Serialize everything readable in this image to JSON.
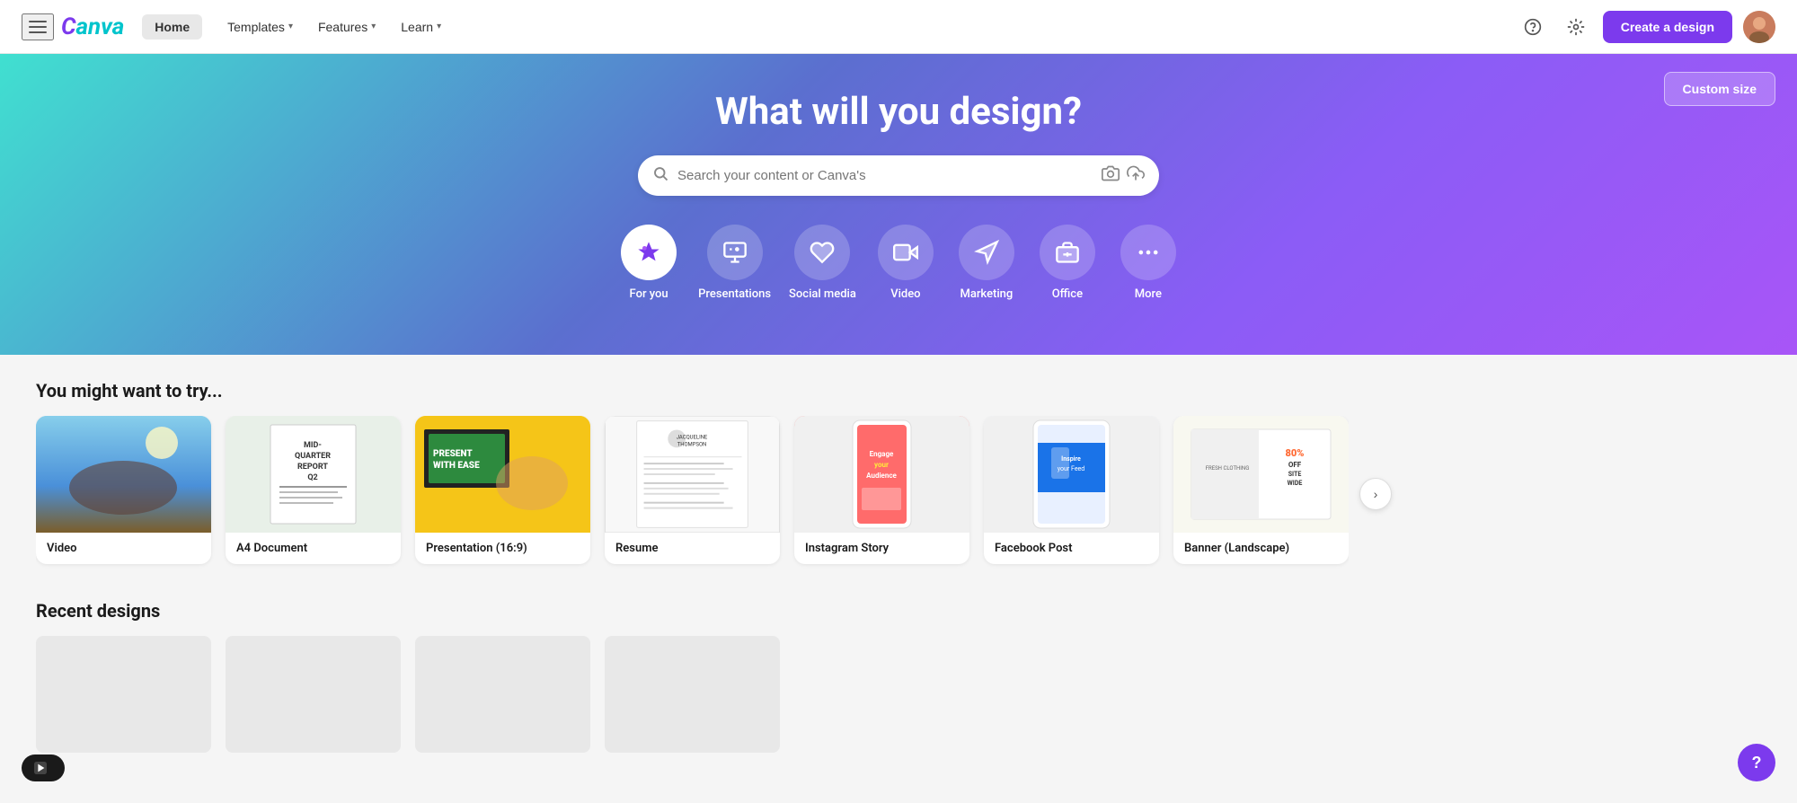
{
  "navbar": {
    "logo": "Canva",
    "home_label": "Home",
    "templates_label": "Templates",
    "features_label": "Features",
    "learn_label": "Learn",
    "create_btn": "Create a design",
    "help_tooltip": "Help",
    "settings_tooltip": "Settings"
  },
  "hero": {
    "title": "What will you design?",
    "search_placeholder": "Search your content or Canva's",
    "custom_size_label": "Custom size"
  },
  "categories": [
    {
      "id": "for-you",
      "label": "For you",
      "icon": "sparkle",
      "active": true
    },
    {
      "id": "presentations",
      "label": "Presentations",
      "icon": "presentation"
    },
    {
      "id": "social-media",
      "label": "Social media",
      "icon": "heart"
    },
    {
      "id": "video",
      "label": "Video",
      "icon": "video"
    },
    {
      "id": "marketing",
      "label": "Marketing",
      "icon": "megaphone"
    },
    {
      "id": "office",
      "label": "Office",
      "icon": "briefcase"
    },
    {
      "id": "more",
      "label": "More",
      "icon": "dots"
    }
  ],
  "suggestions": {
    "title": "You might want to try...",
    "cards": [
      {
        "id": "video",
        "label": "Video"
      },
      {
        "id": "a4-document",
        "label": "A4 Document"
      },
      {
        "id": "presentation",
        "label": "Presentation (16:9)"
      },
      {
        "id": "resume",
        "label": "Resume"
      },
      {
        "id": "instagram-story",
        "label": "Instagram Story"
      },
      {
        "id": "facebook-post",
        "label": "Facebook Post"
      },
      {
        "id": "banner-landscape",
        "label": "Banner (Landscape)"
      }
    ],
    "scroll_label": "›"
  },
  "recent": {
    "title": "Recent designs"
  },
  "float": {
    "video_btn": "▶",
    "help_btn": "?"
  }
}
